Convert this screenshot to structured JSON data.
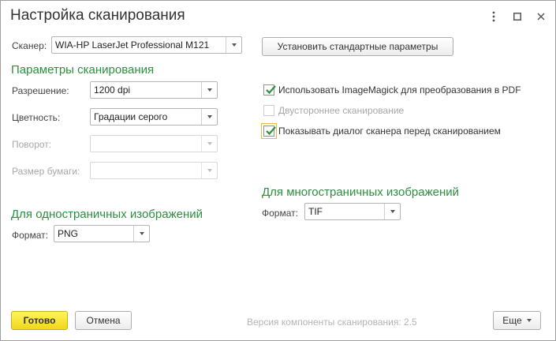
{
  "window": {
    "title": "Настройка сканирования",
    "menu_icon": "kebab-menu-icon",
    "maximize_icon": "maximize-icon",
    "close_icon": "close-icon"
  },
  "scanner": {
    "label": "Сканер:",
    "value": "WIA-HP LaserJet Professional M121",
    "defaults_button": "Установить стандартные параметры"
  },
  "scan_params": {
    "heading": "Параметры сканирования",
    "resolution_label": "Разрешение:",
    "resolution_value": "1200 dpi",
    "color_label": "Цветность:",
    "color_value": "Градации серого",
    "rotation_label": "Поворот:",
    "rotation_value": "",
    "paper_label": "Размер бумаги:",
    "paper_value": ""
  },
  "options": {
    "imagemagick": {
      "label": "Использовать ImageMagick для преобразования в PDF",
      "checked": true
    },
    "duplex": {
      "label": "Двустороннее сканирование",
      "checked": false,
      "disabled": true
    },
    "show_dialog": {
      "label": "Показывать диалог сканера перед сканированием",
      "checked": true
    }
  },
  "single_page": {
    "heading": "Для одностраничных изображений",
    "format_label": "Формат:",
    "format_value": "PNG"
  },
  "multi_page": {
    "heading": "Для многостраничных изображений",
    "format_label": "Формат:",
    "format_value": "TIF"
  },
  "footer": {
    "ok_button": "Готово",
    "cancel_button": "Отмена",
    "version_text": "Версия компоненты сканирования:  2.5",
    "more_button": "Еще"
  }
}
